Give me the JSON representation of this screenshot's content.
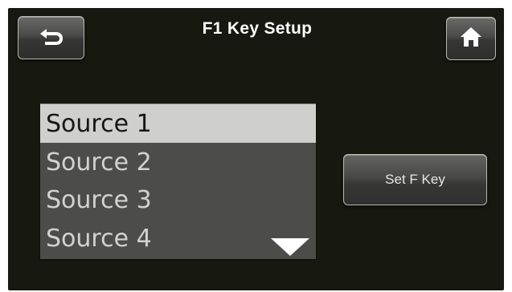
{
  "header": {
    "title": "F1 Key Setup",
    "back_icon": "back-arrow-icon",
    "home_icon": "home-icon"
  },
  "source_list": {
    "items": [
      {
        "label": "Source 1",
        "selected": true
      },
      {
        "label": "Source 2",
        "selected": false
      },
      {
        "label": "Source 3",
        "selected": false
      },
      {
        "label": "Source 4",
        "selected": false
      }
    ],
    "scroll_icon": "triangle-down-icon"
  },
  "actions": {
    "set_key_label": "Set F Key"
  },
  "colors": {
    "background": "#17180f",
    "list_bg": "#4c4c49",
    "selected_bg": "#cfcfcc",
    "text": "#ffffff"
  }
}
